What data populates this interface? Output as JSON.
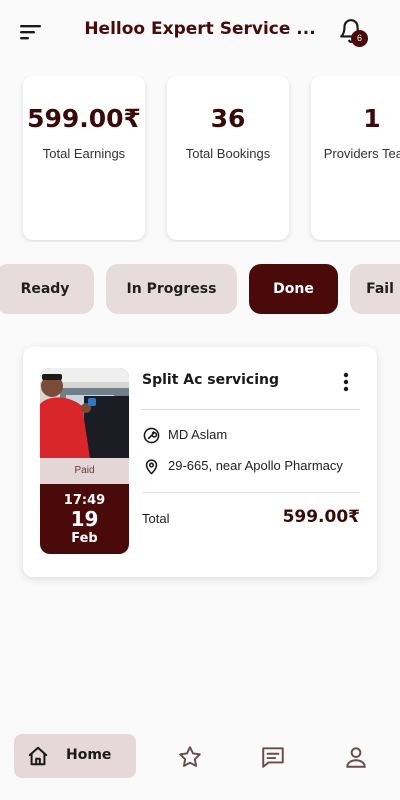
{
  "header": {
    "title": "Helloo Expert Service ...",
    "notification_count": "6",
    "icons": {
      "menu": "menu-icon",
      "bell": "bell-icon"
    }
  },
  "stats": [
    {
      "value": "599.00₹",
      "label": "Total Earnings"
    },
    {
      "value": "36",
      "label": "Total Bookings"
    },
    {
      "value": "1",
      "label": "Providers Teams"
    }
  ],
  "tabs": [
    {
      "label": "Ready",
      "active": false
    },
    {
      "label": "In Progress",
      "active": false
    },
    {
      "label": "Done",
      "active": true
    },
    {
      "label": "Fail",
      "active": false
    }
  ],
  "booking": {
    "service": "Split Ac servicing",
    "status": "Paid",
    "time": "17:49",
    "day": "19",
    "month": "Feb",
    "provider": "MD Aslam",
    "address": "29-665, near Apollo Pharmacy",
    "total_label": "Total",
    "total_value": "599.00₹",
    "icons": {
      "provider": "wrench-icon",
      "address": "location-pin-icon",
      "more": "more-vertical-icon"
    }
  },
  "bottom_nav": {
    "items": [
      {
        "label": "Home",
        "icon": "home-icon",
        "active": true
      },
      {
        "label": "",
        "icon": "star-icon",
        "active": false
      },
      {
        "label": "",
        "icon": "chat-icon",
        "active": false
      },
      {
        "label": "",
        "icon": "profile-icon",
        "active": false
      }
    ]
  },
  "colors": {
    "accent": "#4a0a0a",
    "chip_bg": "#e6dcdc",
    "page_bg": "#fafafa"
  }
}
